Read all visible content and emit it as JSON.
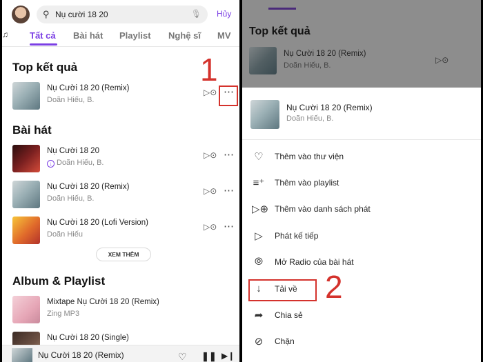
{
  "left": {
    "search": {
      "value": "Nụ cười 18 20",
      "cancel_label": "Hủy"
    },
    "tabs": [
      "Tất cả",
      "Bài hát",
      "Playlist",
      "Nghệ sĩ",
      "MV"
    ],
    "sections": {
      "top": "Top kết quả",
      "songs": "Bài hát",
      "albums": "Album & Playlist"
    },
    "top_result": {
      "title": "Nụ Cười 18 20 (Remix)",
      "artist": "Doãn Hiếu, B."
    },
    "songs": [
      {
        "title": "Nụ Cười 18 20",
        "artist": "Doãn Hiếu, B."
      },
      {
        "title": "Nụ Cười 18 20 (Remix)",
        "artist": "Doãn Hiếu, B."
      },
      {
        "title": "Nụ Cười 18 20 (Lofi Version)",
        "artist": "Doãn Hiếu"
      }
    ],
    "see_more": "XEM THÊM",
    "albums": [
      {
        "title": "Mixtape Nụ Cười 18 20 (Remix)",
        "artist": "Zing MP3"
      },
      {
        "title": "Nụ Cười 18 20 (Single)",
        "artist": ""
      }
    ],
    "player": {
      "title": "Nụ Cười 18 20 (Remix)"
    },
    "annotation": "1"
  },
  "right": {
    "dim": {
      "title": "Top kết quả",
      "song_title": "Nụ Cười 18 20 (Remix)",
      "song_artist": "Doãn Hiếu, B."
    },
    "sheet": {
      "song_title": "Nụ Cười 18 20 (Remix)",
      "song_artist": "Doãn Hiếu, B.",
      "items": [
        {
          "label": "Thêm vào thư viện",
          "icon": "heart-icon"
        },
        {
          "label": "Thêm vào playlist",
          "icon": "add-playlist-icon"
        },
        {
          "label": "Thêm vào danh sách phát",
          "icon": "queue-add-icon"
        },
        {
          "label": "Phát kế tiếp",
          "icon": "play-next-icon"
        },
        {
          "label": "Mở Radio của bài hát",
          "icon": "radio-icon"
        },
        {
          "label": "Tải về",
          "icon": "download-icon"
        },
        {
          "label": "Chia sẻ",
          "icon": "share-icon"
        },
        {
          "label": "Chặn",
          "icon": "block-icon"
        }
      ]
    },
    "annotation": "2"
  },
  "colors": {
    "accent": "#7b3fe4",
    "annotation_red": "#d4322c"
  }
}
